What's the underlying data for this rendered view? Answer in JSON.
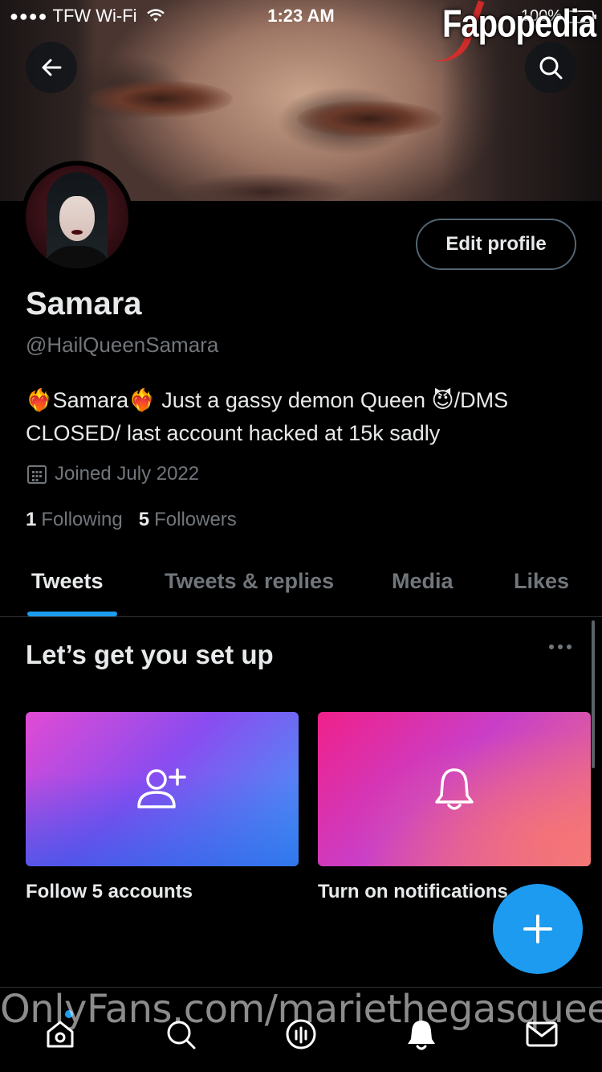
{
  "status_bar": {
    "carrier": "TFW Wi-Fi",
    "time": "1:23 AM",
    "battery_percent": "100%"
  },
  "watermarks": {
    "top": "Fapopedia",
    "bottom": "OnlyFans.com/mariethegasqueen"
  },
  "header": {
    "back_icon": "arrow-left-icon",
    "search_icon": "search-icon"
  },
  "profile": {
    "edit_label": "Edit profile",
    "name": "Samara",
    "handle": "@HailQueenSamara",
    "bio": "❤️‍🔥Samara❤️‍🔥 Just a gassy demon Queen 😈/DMS CLOSED/ last account hacked at 15k sadly",
    "joined": "Joined July 2022",
    "following_count": "1",
    "following_label": "Following",
    "followers_count": "5",
    "followers_label": "Followers"
  },
  "tabs": [
    {
      "label": "Tweets",
      "active": true
    },
    {
      "label": "Tweets & replies",
      "active": false
    },
    {
      "label": "Media",
      "active": false
    },
    {
      "label": "Likes",
      "active": false
    }
  ],
  "setup": {
    "title": "Let’s get you set up",
    "cards": [
      {
        "label": "Follow 5 accounts",
        "icon": "add-user-icon"
      },
      {
        "label": "Turn on notifications",
        "icon": "bell-icon"
      }
    ]
  },
  "nav": {
    "items": [
      "home-icon",
      "search-icon",
      "spaces-icon",
      "notifications-icon",
      "messages-icon"
    ]
  },
  "colors": {
    "accent": "#1d9bf0",
    "background": "#000000",
    "secondary_text": "#71767b",
    "border": "#2f3336"
  }
}
